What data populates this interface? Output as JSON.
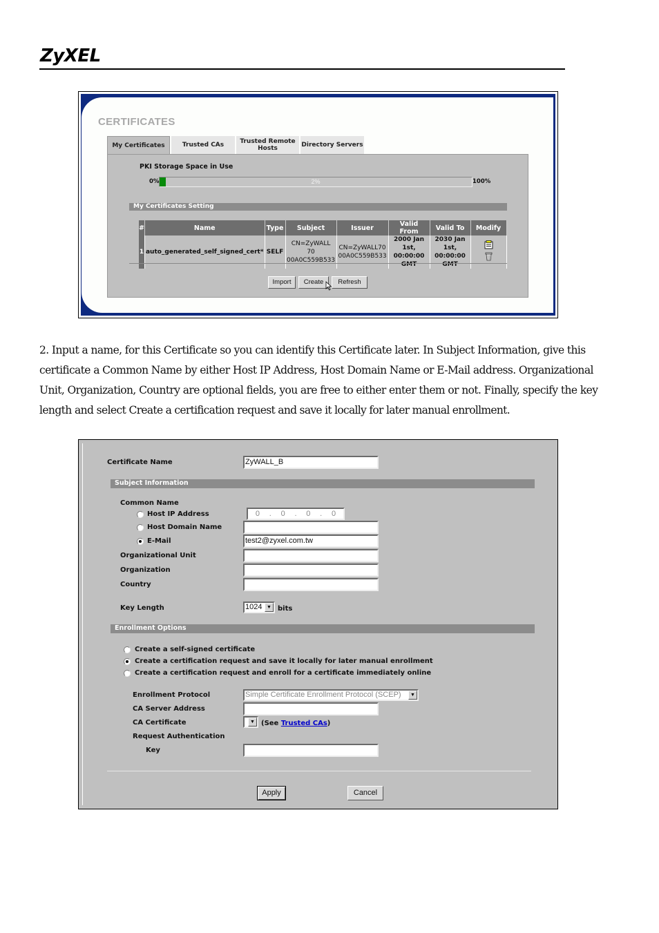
{
  "header": {
    "logo": "ZyXEL"
  },
  "screenshot1": {
    "title": "CERTIFICATES",
    "tabs": [
      {
        "label": "My Certificates",
        "active": true
      },
      {
        "label": "Trusted CAs",
        "active": false
      },
      {
        "label": "Trusted Remote Hosts",
        "active": false
      },
      {
        "label": "Directory Servers",
        "active": false
      }
    ],
    "storage": {
      "label": "PKI Storage Space in Use",
      "min_label": "0%",
      "max_label": "100%",
      "value_label": "2%",
      "value_percent": 2,
      "fill_color": "#078a0a"
    },
    "section_title": "My Certificates Setting",
    "table": {
      "headers": [
        "#",
        "Name",
        "Type",
        "Subject",
        "Issuer",
        "Valid From",
        "Valid To",
        "Modify"
      ],
      "rows": [
        {
          "index": "1",
          "name": "auto_generated_self_signed_cert*",
          "type": "SELF",
          "subject": [
            "CN=ZyWALL",
            "70",
            "00A0C559B533"
          ],
          "issuer": [
            "CN=ZyWALL70",
            "00A0C559B533"
          ],
          "valid_from": [
            "2000 Jan",
            "1st, 00:00:00",
            "GMT"
          ],
          "valid_to": [
            "2030 Jan",
            "1st, 00:00:00",
            "GMT"
          ],
          "modify_icons": [
            "edit-icon",
            "delete-icon"
          ]
        }
      ]
    },
    "buttons": {
      "import": "Import",
      "create": "Create",
      "refresh": "Refresh"
    }
  },
  "paragraph": {
    "text": "2. Input a name, for this Certificate so you can identify this Certificate later. In Subject Information, give this certificate a Common Name by either Host IP Address, Host Domain Name or E-Mail address. Organizational Unit, Organization, Country are optional fields, you are free to either enter them or not. Finally, specify the key length and select ",
    "bold": "Create a certification request and save it locally for later manual enrollment",
    "end": "."
  },
  "screenshot2": {
    "certificate_name_label": "Certificate Name",
    "certificate_name_value": "ZyWALL_B",
    "subject_section": "Subject Information",
    "common_name_label": "Common Name",
    "host_ip_label": "Host IP Address",
    "host_ip_octets": [
      "0",
      "0",
      "0",
      "0"
    ],
    "host_ip_sep": ".",
    "host_domain_label": "Host Domain Name",
    "host_domain_value": "",
    "email_label": "E-Mail",
    "email_value": "test2@zyxel.com.tw",
    "common_name_selected": "E-Mail",
    "org_unit_label": "Organizational Unit",
    "org_unit_value": "",
    "organization_label": "Organization",
    "organization_value": "",
    "country_label": "Country",
    "country_value": "",
    "key_length_label": "Key Length",
    "key_length_value": "1024",
    "key_length_unit": "bits",
    "enrollment_section": "Enrollment Options",
    "enrollment_options": [
      {
        "label": "Create a self-signed certificate",
        "selected": false
      },
      {
        "label": "Create a certification request and save it locally for later manual enrollment",
        "selected": true
      },
      {
        "label": "Create a certification request and enroll for a certificate immediately online",
        "selected": false
      }
    ],
    "enrollment_protocol_label": "Enrollment Protocol",
    "enrollment_protocol_value": "Simple Certificate Enrollment Protocol (SCEP)",
    "ca_server_label": "CA Server Address",
    "ca_server_value": "",
    "ca_certificate_label": "CA Certificate",
    "ca_certificate_see_prefix": "(See ",
    "ca_certificate_link": "Trusted CAs",
    "ca_certificate_see_suffix": ")",
    "request_auth_label": "Request Authentication",
    "key_label": "Key",
    "key_value": "",
    "buttons": {
      "apply": "Apply",
      "cancel": "Cancel"
    }
  }
}
